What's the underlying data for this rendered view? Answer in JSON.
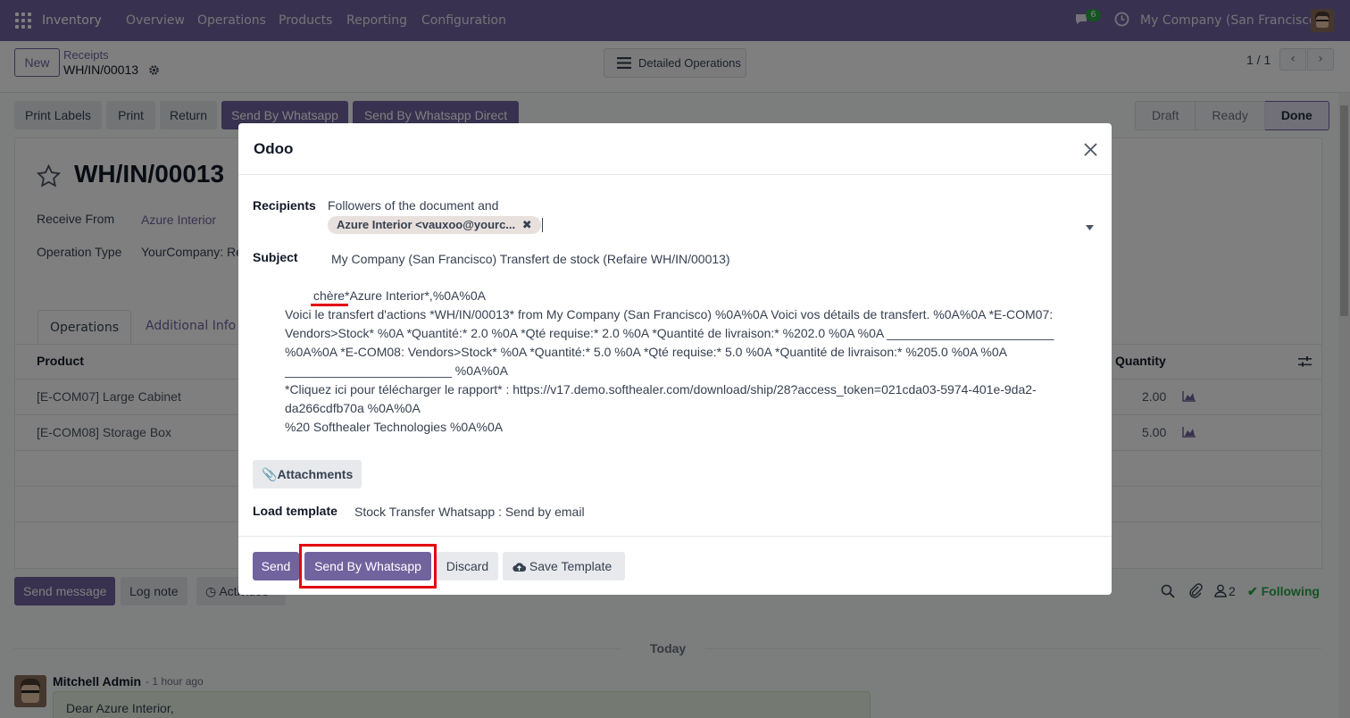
{
  "navbar": {
    "app_name": "Inventory",
    "menu": [
      "Overview",
      "Operations",
      "Products",
      "Reporting",
      "Configuration"
    ],
    "chat_count": "6",
    "company": "My Company (San Francisco)"
  },
  "control": {
    "new_label": "New",
    "breadcrumb_parent": "Receipts",
    "record_name": "WH/IN/00013",
    "detailed_ops_label": "Detailed Operations",
    "pager": "1 / 1"
  },
  "actions": [
    "Print Labels",
    "Print",
    "Return",
    "Send By Whatsapp",
    "Send By Whatsapp Direct"
  ],
  "status": [
    "Draft",
    "Ready",
    "Done"
  ],
  "sheet": {
    "title": "WH/IN/00013",
    "receive_from_label": "Receive From",
    "receive_from_value": "Azure Interior",
    "operation_type_label": "Operation Type",
    "operation_type_value": "YourCompany: Re",
    "tabs": [
      "Operations",
      "Additional Info"
    ],
    "col_product": "Product",
    "col_quantity": "Quantity",
    "rows": [
      {
        "product": "[E-COM07] Large Cabinet",
        "qty": "2.00"
      },
      {
        "product": "[E-COM08] Storage Box",
        "qty": "5.00"
      }
    ]
  },
  "chatter": {
    "send_message": "Send message",
    "log_note": "Log note",
    "activities": "Activities",
    "followers_count": "2",
    "following": "Following",
    "today": "Today",
    "author": "Mitchell Admin",
    "time": "- 1 hour ago",
    "message": "Dear Azure Interior,"
  },
  "modal": {
    "title": "Odoo",
    "recipients_label": "Recipients",
    "recipients_text": "Followers of the document and",
    "recipient_tag": "Azure Interior <vauxoo@yourc...",
    "subject_label": "Subject",
    "subject_value": "My Company (San Francisco) Transfert de stock (Refaire WH/IN/00013)",
    "body_first_word": "chère",
    "body_first_rest": " *Azure Interior*,%0A%0A",
    "body_lines": [
      "Voici le transfert d'actions *WH/IN/00013* from My Company (San Francisco) %0A%0A Voici vos détails de transfert. %0A%0A *E-COM07:",
      "Vendors>Stock* %0A *Quantité:* 2.0 %0A *Qté requise:* 2.0 %0A *Quantité de livraison:* %202.0 %0A %0A ________________________",
      "%0A%0A *E-COM08: Vendors>Stock* %0A *Quantité:* 5.0 %0A *Qté requise:* 5.0 %0A *Quantité de livraison:* %205.0 %0A %0A",
      "________________________ %0A%0A",
      "*Cliquez ici pour télécharger le rapport* : https://v17.demo.softhealer.com/download/ship/28?access_token=021cda03-5974-401e-9da2-",
      "da266cdfb70a %0A%0A",
      "%20 Softhealer Technologies %0A%0A"
    ],
    "attachments_label": "Attachments",
    "load_template_label": "Load template",
    "load_template_value": "Stock Transfer Whatsapp : Send by email",
    "send_label": "Send",
    "send_whatsapp_label": "Send By Whatsapp",
    "discard_label": "Discard",
    "save_template_label": "Save Template"
  },
  "colors": {
    "brand": "#71639e",
    "highlight": "#e3070d",
    "following": "#28a745"
  }
}
